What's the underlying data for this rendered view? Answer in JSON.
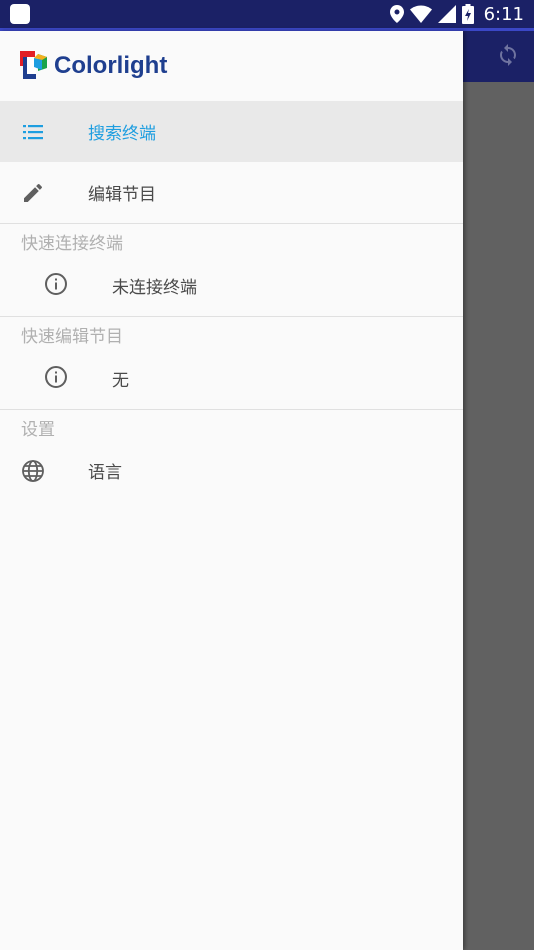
{
  "status_bar": {
    "time": "6:11",
    "icons": [
      "app-icon",
      "location-icon",
      "wifi-icon",
      "signal-icon",
      "battery-icon"
    ]
  },
  "appbar": {
    "action_icon": "refresh-icon"
  },
  "drawer": {
    "logo_text": "Colorlight",
    "menu": [
      {
        "label": "搜索终端",
        "icon": "list-icon",
        "active": true
      },
      {
        "label": "编辑节目",
        "icon": "pencil-icon",
        "active": false
      }
    ],
    "sections": [
      {
        "header": "快速连接终端",
        "item_label": "未连接终端",
        "item_icon": "info-icon"
      },
      {
        "header": "快速编辑节目",
        "item_label": "无",
        "item_icon": "info-icon"
      },
      {
        "header": "设置",
        "item_label": "语言",
        "item_icon": "globe-icon"
      }
    ]
  },
  "colors": {
    "status_bar": "#1b2166",
    "accent": "#1e9ee0",
    "logo": "#1f3f8f"
  }
}
